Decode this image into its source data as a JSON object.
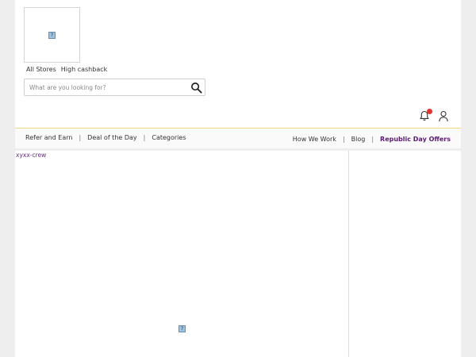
{
  "header": {
    "logo_alt": "?",
    "quick_links": [
      "All Stores",
      "High cashback"
    ]
  },
  "search": {
    "placeholder": "What are you looking for?",
    "icon": "search-icon"
  },
  "actions": {
    "bell_icon": "bell-icon",
    "user_icon": "user-icon"
  },
  "nav": {
    "left": [
      "Refer and Earn",
      "Deal of the Day",
      "Categories"
    ],
    "right": [
      "How We Work",
      "Blog",
      "Republic Day Offers"
    ],
    "separator": "|"
  },
  "main": {
    "widget_text": "xyxx-crew",
    "image_alt": "?"
  },
  "colors": {
    "promo": "#5b1a72",
    "nav_border": "#f3d97a",
    "badge": "#e0342f"
  }
}
